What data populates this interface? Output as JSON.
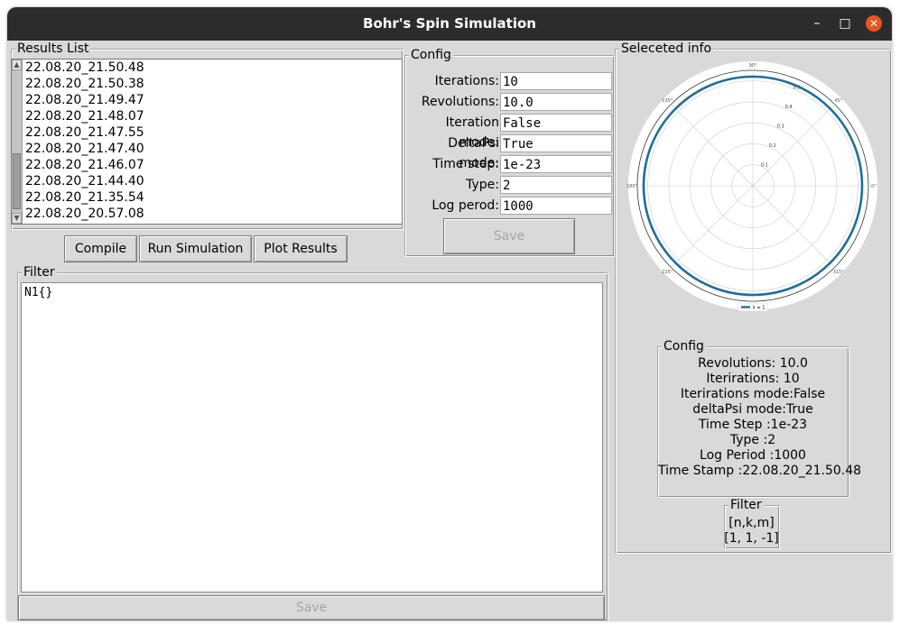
{
  "window": {
    "title": "Bohr's Spin Simulation"
  },
  "results": {
    "title": "Results List",
    "items": [
      "22.08.20_21.50.48",
      "22.08.20_21.50.38",
      "22.08.20_21.49.47",
      "22.08.20_21.48.07",
      "22.08.20_21.47.55",
      "22.08.20_21.47.40",
      "22.08.20_21.46.07",
      "22.08.20_21.44.40",
      "22.08.20_21.35.54",
      "22.08.20_20.57.08"
    ]
  },
  "actions": {
    "compile": "Compile",
    "run": "Run Simulation",
    "plot": "Plot Results"
  },
  "config": {
    "title": "Config",
    "fields": [
      {
        "label": "Iterations:",
        "value": "10"
      },
      {
        "label": "Revolutions:",
        "value": "10.0"
      },
      {
        "label": "Iteration mode:",
        "value": "False"
      },
      {
        "label": "DeltaPsi mode:",
        "value": "True"
      },
      {
        "label": "Time step:",
        "value": "1e-23"
      },
      {
        "label": "Type:",
        "value": "2"
      },
      {
        "label": "Log perod:",
        "value": "1000"
      }
    ],
    "save": "Save"
  },
  "filter": {
    "title": "Filter",
    "text": "N1{}",
    "save": "Save"
  },
  "selected": {
    "title": "Seleceted info",
    "config_title": "Config",
    "lines": [
      "Revolutions: 10.0",
      "Iterirations: 10",
      "Iterirations mode:False",
      "deltaPsi mode:True",
      "Time Step :1e-23",
      "Type :2",
      "Log Period :1000",
      "Time Stamp :22.08.20_21.50.48"
    ],
    "filter_title": "Filter",
    "filter_lines": [
      "[n,k,m]",
      "[1, 1, -1]"
    ]
  },
  "chart_data": {
    "type": "polar-line",
    "angle_ticks": [
      "0°",
      "45°",
      "90°",
      "135°",
      "180°",
      "225°",
      "270°",
      "315°"
    ],
    "radial_ticks": [
      "0.1",
      "0.2",
      "0.3",
      "0.4",
      "0.5"
    ],
    "series": [
      {
        "name": "k = 1",
        "r": 0.52,
        "color": "#1f6e9c"
      }
    ],
    "legend": "bottom"
  }
}
